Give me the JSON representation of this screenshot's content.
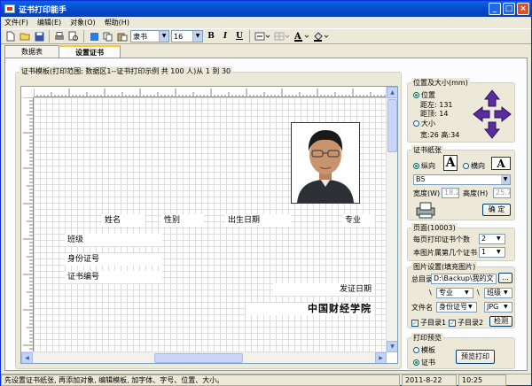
{
  "window": {
    "title": "证书打印能手",
    "controls": [
      "_",
      "□",
      "×"
    ]
  },
  "menu": [
    "文件(F)",
    "编辑(E)",
    "对象(O)",
    "帮助(H)"
  ],
  "toolbar": {
    "font_name": "隶书",
    "font_size": "16",
    "bold": "B",
    "italic": "I",
    "underline": "U"
  },
  "tabs": [
    {
      "label": "数据表"
    },
    {
      "label": "设置证书"
    }
  ],
  "template": {
    "heading": "证书模板(打印范围: 数据区1--证书打印示例 共 100 人)从 1 到 30",
    "fields": {
      "name": "姓名",
      "gender": "性别",
      "birthdate": "出生日期",
      "major": "专业",
      "class": "班级",
      "id_number": "身份证号",
      "cert_number": "证书编号",
      "issue_date": "发证日期",
      "issuer": "中国财经学院"
    }
  },
  "position": {
    "title": "位置及大小(mm)",
    "position_label": "位置",
    "left_label": "距左: 131",
    "top_label": "距顶: 14",
    "size_label": "大小",
    "size_value": "宽:26 高:34"
  },
  "paper": {
    "title": "证书纸张",
    "portrait": "纵向",
    "landscape": "横向",
    "paper_size": "B5",
    "width_label": "宽度(W)",
    "width_value": "18.2",
    "height_label": "高度(H)",
    "height_value": "25.7",
    "ok": "确 定"
  },
  "page": {
    "title": "页面(10003)",
    "per_page_label": "每页打印证书个数",
    "per_page_value": "2",
    "index_label": "本图片属第几个证书",
    "index_value": "1"
  },
  "image": {
    "title": "图片设置(填充图片)",
    "root_label": "总目录",
    "root_value": "D:\\Backup\\我的文",
    "browse": "...",
    "subdir1": "专业",
    "subdir2": "班级",
    "filename_label": "文件名",
    "filename_value": "身份证号",
    "ext_value": "JPG",
    "sub1_label": "子目录1",
    "sub2_label": "子目录2",
    "detect": "检测"
  },
  "preview": {
    "title": "打印预览",
    "template_label": "模板",
    "cert_label": "证书",
    "button": "预览打印"
  },
  "status": {
    "hint": "先设置证书纸张, 再添加对象, 编辑模板, 加字体、字号、位置、大小。",
    "date": "2011-8-22",
    "time": "10:25"
  }
}
